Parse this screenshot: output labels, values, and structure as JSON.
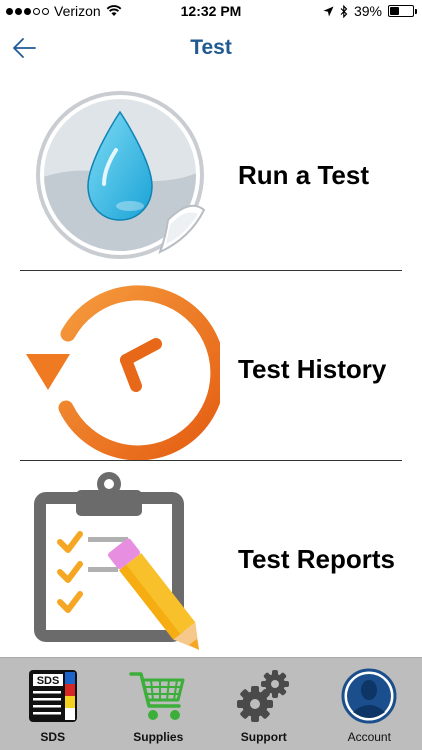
{
  "status_bar": {
    "carrier": "Verizon",
    "time": "12:32 PM",
    "battery": "39%",
    "battery_level": 0.39,
    "signal_bars": 3,
    "signal_total": 5
  },
  "nav": {
    "title": "Test",
    "back_icon": "arrow-left-icon"
  },
  "menu": [
    {
      "label": "Run a Test",
      "icon": "water-drop-icon"
    },
    {
      "label": "Test History",
      "icon": "clock-history-icon"
    },
    {
      "label": "Test Reports",
      "icon": "clipboard-checklist-icon"
    }
  ],
  "tabs": [
    {
      "label": "SDS",
      "icon": "sds-binder-icon"
    },
    {
      "label": "Supplies",
      "icon": "shopping-cart-icon"
    },
    {
      "label": "Support",
      "icon": "gears-icon"
    },
    {
      "label": "Account",
      "icon": "user-avatar-icon"
    }
  ],
  "colors": {
    "title": "#1f5a93",
    "drop": "#3cc0e8",
    "clock": "#f07a22",
    "clipboard": "#6b6b6b",
    "checks": "#f5a623",
    "pencil": "#f8c12c",
    "cart": "#3cae3a",
    "account": "#1a4e8c",
    "tab_bar": "#bdbdbd"
  },
  "sds_badge": "SDS"
}
